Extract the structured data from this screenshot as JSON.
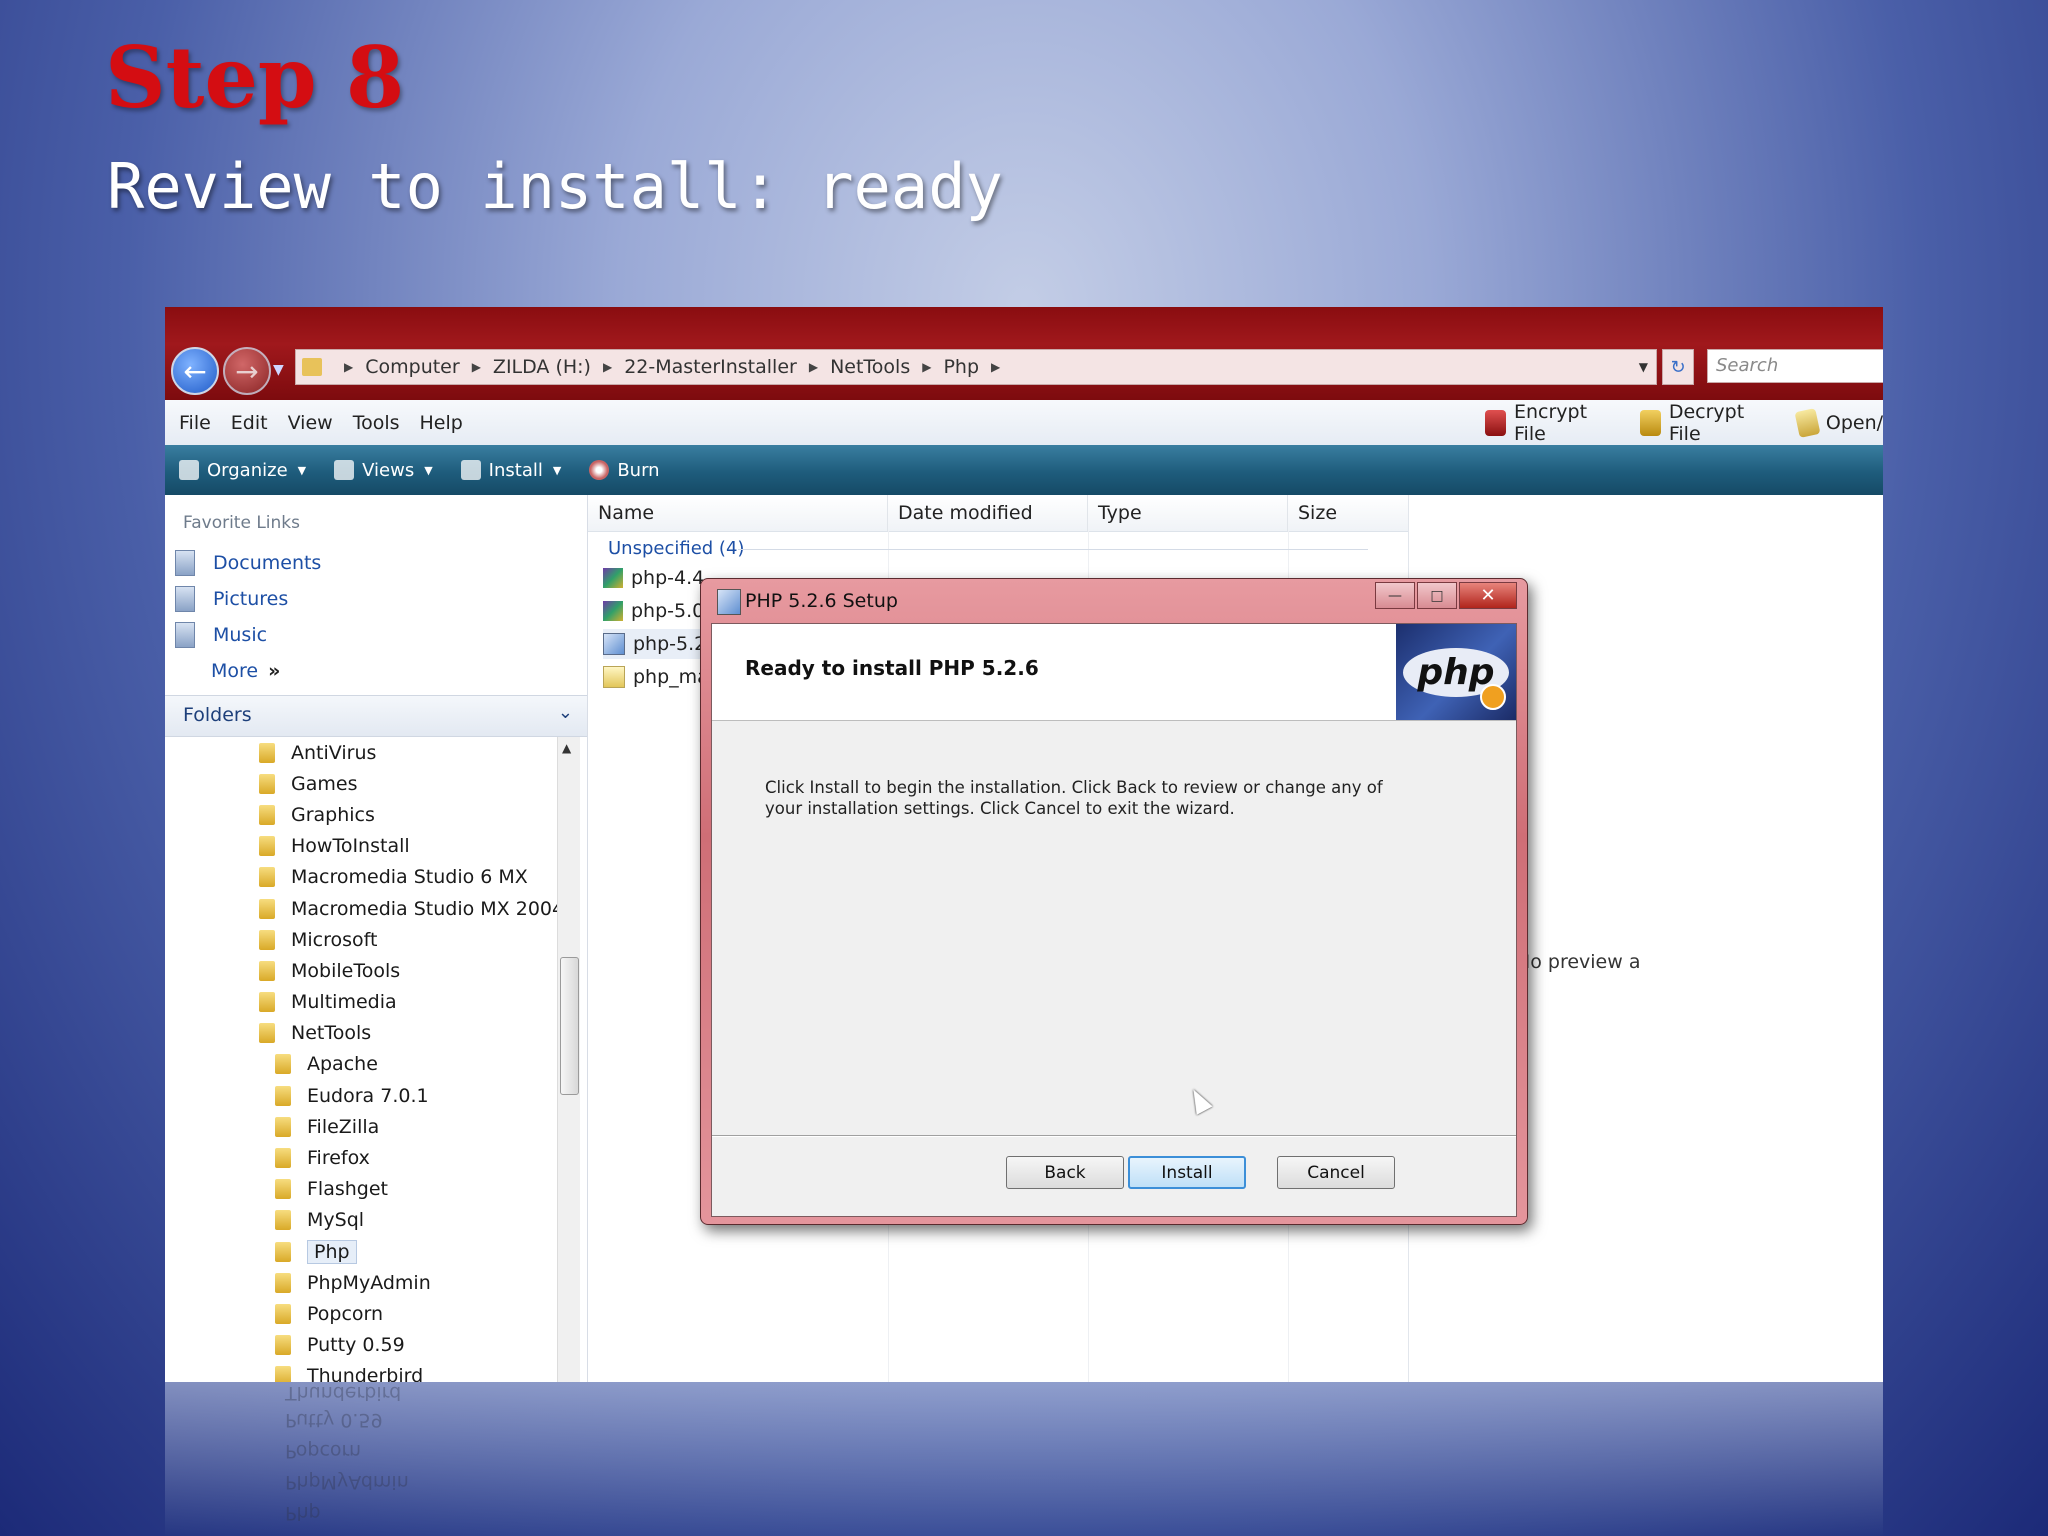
{
  "slide": {
    "title": "Step 8",
    "subtitle": "Review to install: ready"
  },
  "explorer": {
    "breadcrumb": [
      "Computer",
      "ZILDA (H:)",
      "22-MasterInstaller",
      "NetTools",
      "Php"
    ],
    "search_placeholder": "Search",
    "menu": [
      "File",
      "Edit",
      "View",
      "Tools",
      "Help"
    ],
    "menu_actions": [
      "Encrypt File",
      "Decrypt File",
      "Open/"
    ],
    "toolbar": [
      "Organize",
      "Views",
      "Install",
      "Burn"
    ],
    "favorite_links_label": "Favorite Links",
    "favorites": [
      "Documents",
      "Pictures",
      "Music",
      "More"
    ],
    "favorites_more_glyph": "»",
    "folders_label": "Folders",
    "folders": [
      "AntiVirus",
      "Games",
      "Graphics",
      "HowToInstall",
      "Macromedia Studio 6 MX",
      "Macromedia Studio MX 2004",
      "Microsoft",
      "MobileTools",
      "Multimedia",
      "NetTools",
      "Apache",
      "Eudora 7.0.1",
      "FileZilla",
      "Firefox",
      "Flashget",
      "MySql",
      "Php",
      "PhpMyAdmin",
      "Popcorn",
      "Putty 0.59",
      "Thunderbird"
    ],
    "selected_folder": "Php",
    "columns": [
      "Name",
      "Date modified",
      "Type",
      "Size"
    ],
    "group_label": "Unspecified (4)",
    "files": [
      "php-4.4",
      "php-5.0",
      "php-5.2",
      "php_ma"
    ],
    "preview_text": "No preview a"
  },
  "dialog": {
    "title": "PHP 5.2.6 Setup",
    "heading": "Ready to install PHP 5.2.6",
    "body": "Click Install to begin the installation. Click Back to review or change any of your installation settings. Click Cancel to exit the wizard.",
    "logo_text": "php",
    "buttons": {
      "back": "Back",
      "install": "Install",
      "cancel": "Cancel"
    }
  },
  "reflection": [
    "Php",
    "PhpMyAdmin",
    "Popcorn",
    "Putty 0.59",
    "Thunderbird"
  ]
}
